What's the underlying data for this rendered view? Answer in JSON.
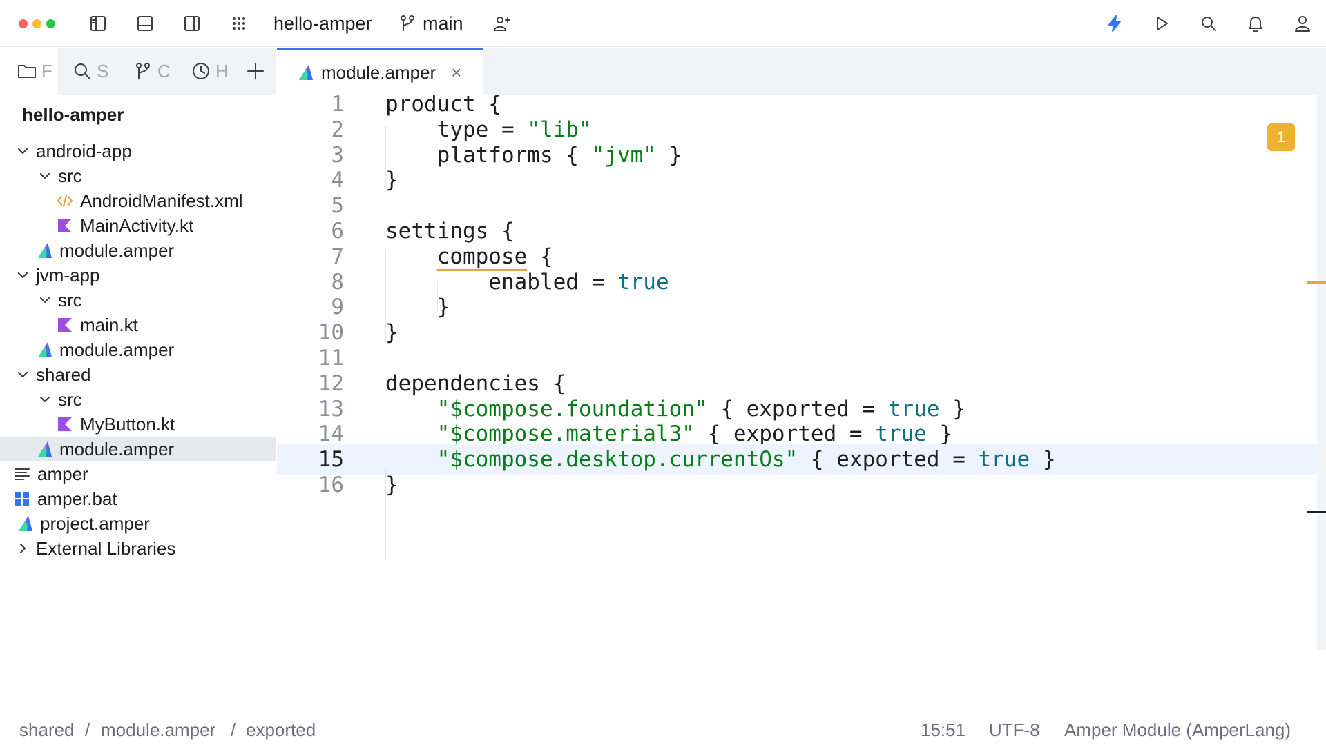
{
  "window": {
    "project_name": "hello-amper",
    "branch": "main"
  },
  "colors": {
    "traffic_close": "#fe5f57",
    "traffic_minimize": "#febc2e",
    "traffic_zoom": "#28c840",
    "accent": "#3574f0",
    "string": "#067d17",
    "keyword_value": "#0f6f82",
    "warning": "#f0b132"
  },
  "toolbar": {
    "icons": [
      "sidebar-left-icon",
      "bottom-panel-icon",
      "sidebar-right-icon",
      "apps-grid-icon",
      "branch-icon",
      "add-user-icon",
      "lightning-icon",
      "run-icon",
      "search-icon",
      "bell-icon",
      "user-icon"
    ]
  },
  "left_tabs": [
    {
      "icon": "folder-icon",
      "label": "F"
    },
    {
      "icon": "search-icon",
      "label": "S"
    },
    {
      "icon": "branch-icon",
      "label": "C"
    },
    {
      "icon": "clock-icon",
      "label": "H"
    }
  ],
  "tree": {
    "root": "hello-amper",
    "items": [
      {
        "label": "android-app",
        "expanded": true,
        "icon": "none"
      },
      {
        "label": "src",
        "expanded": true,
        "icon": "none"
      },
      {
        "label": "AndroidManifest.xml",
        "icon": "xml-icon"
      },
      {
        "label": "MainActivity.kt",
        "icon": "kotlin-icon"
      },
      {
        "label": "module.amper",
        "icon": "amper-icon"
      },
      {
        "label": "jvm-app",
        "expanded": true,
        "icon": "none"
      },
      {
        "label": "src",
        "expanded": true,
        "icon": "none"
      },
      {
        "label": "main.kt",
        "icon": "kotlin-icon"
      },
      {
        "label": "module.amper",
        "icon": "amper-icon"
      },
      {
        "label": "shared",
        "expanded": true,
        "icon": "none"
      },
      {
        "label": "src",
        "expanded": true,
        "icon": "none"
      },
      {
        "label": "MyButton.kt",
        "icon": "kotlin-icon"
      },
      {
        "label": "module.amper",
        "icon": "amper-icon",
        "selected": true
      },
      {
        "label": "amper",
        "icon": "text-file-icon"
      },
      {
        "label": "amper.bat",
        "icon": "windows-icon"
      },
      {
        "label": "project.amper",
        "icon": "amper-icon"
      },
      {
        "label": "External Libraries",
        "expanded": false,
        "icon": "none"
      }
    ]
  },
  "editor": {
    "tab_label": "module.amper",
    "warning_count": "1",
    "current_line": 15,
    "line_numbers": [
      "1",
      "2",
      "3",
      "4",
      "5",
      "6",
      "7",
      "8",
      "9",
      "10",
      "11",
      "12",
      "13",
      "14",
      "15",
      "16"
    ],
    "lines": [
      "product {",
      "    type = \"lib\"",
      "    platforms { \"jvm\" }",
      "}",
      "",
      "settings {",
      "    compose {",
      "        enabled = true",
      "    }",
      "}",
      "",
      "dependencies {",
      "    \"$compose.foundation\" { exported = true }",
      "    \"$compose.material3\" { exported = true }",
      "    \"$compose.desktop.currentOs\" { exported = true }",
      "}"
    ]
  },
  "status": {
    "breadcrumb": [
      "shared",
      "module.amper",
      "exported"
    ],
    "separator": "/",
    "position": "15:51",
    "encoding": "UTF-8",
    "file_type": "Amper Module (AmperLang)"
  }
}
